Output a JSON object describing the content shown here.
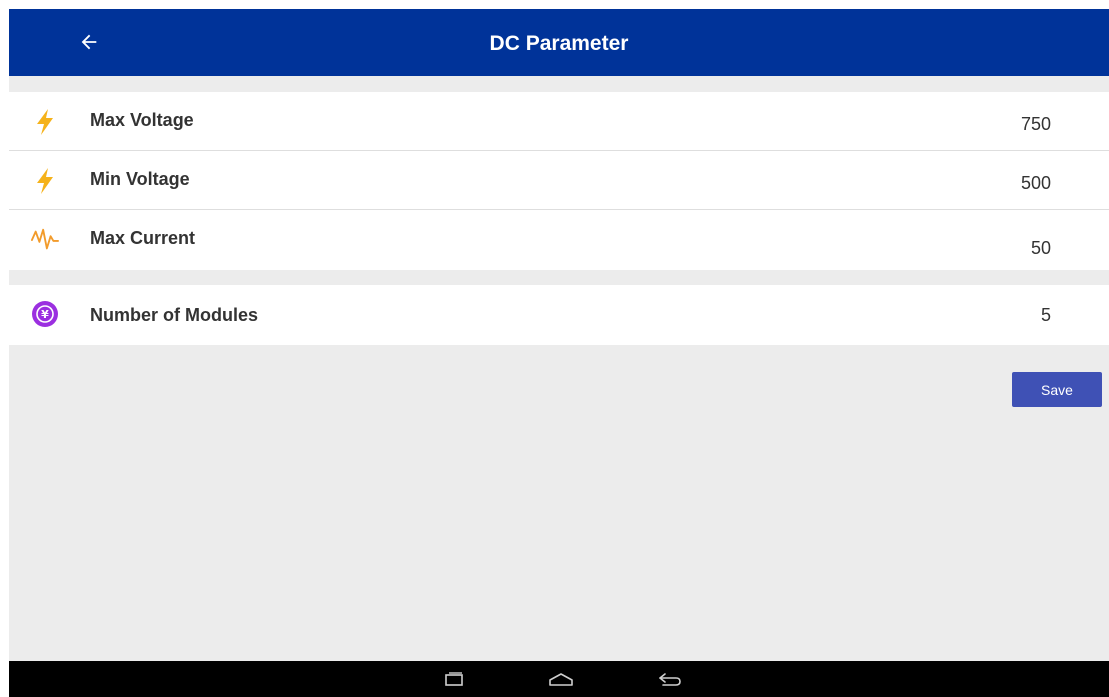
{
  "app_bar": {
    "title": "DC Parameter",
    "back_icon": "arrow-back-icon",
    "background": "#003399"
  },
  "parameters": [
    {
      "label": "Max Voltage",
      "value": "750",
      "icon": "lightning-icon"
    },
    {
      "label": "Min Voltage",
      "value": "500",
      "icon": "lightning-icon"
    },
    {
      "label": "Max Current",
      "value": "50",
      "icon": "current-wave-icon"
    }
  ],
  "modules": {
    "label": "Number of Modules",
    "value": "5",
    "icon": "module-circle-icon"
  },
  "save_label": "Save",
  "colors": {
    "accent": "#3f51b5",
    "icon_yellow": "#f5b21a",
    "icon_orange": "#f29b2b",
    "icon_purple": "#9b2fe0"
  },
  "system_nav": {
    "recent_icon": "recent-apps-icon",
    "home_icon": "home-icon",
    "back_icon": "back-icon"
  }
}
